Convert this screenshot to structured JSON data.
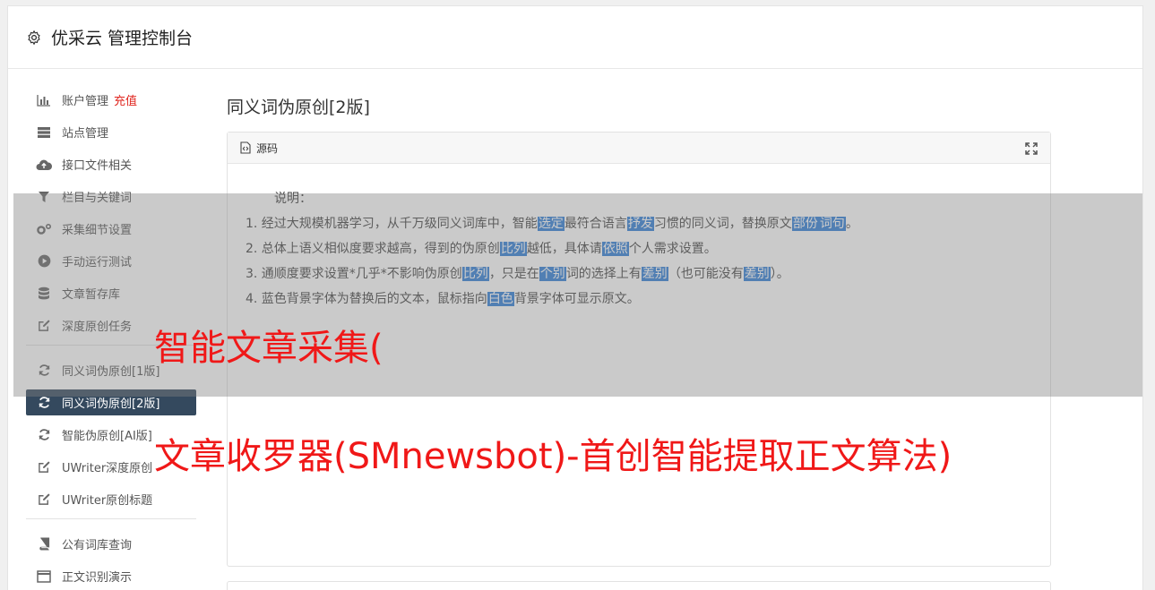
{
  "header": {
    "title": "优采云 管理控制台",
    "icon": "gear-icon"
  },
  "sidebar": {
    "group1": [
      {
        "label": "账户管理",
        "badge": "充值",
        "icon": "bar-chart-icon"
      },
      {
        "label": "站点管理",
        "icon": "server-icon"
      },
      {
        "label": "接口文件相关",
        "icon": "cloud-upload-icon"
      },
      {
        "label": "栏目与关键词",
        "icon": "filter-icon"
      },
      {
        "label": "采集细节设置",
        "icon": "cogs-icon"
      },
      {
        "label": "手动运行测试",
        "icon": "play-circle-icon"
      },
      {
        "label": "文章暂存库",
        "icon": "database-icon"
      },
      {
        "label": "深度原创任务",
        "icon": "edit-icon"
      }
    ],
    "group2": [
      {
        "label": "同义词伪原创[1版]",
        "icon": "refresh-icon"
      },
      {
        "label": "同义词伪原创[2版]",
        "icon": "refresh-icon",
        "active": true
      },
      {
        "label": "智能伪原创[AI版]",
        "icon": "refresh-icon"
      },
      {
        "label": "UWriter深度原创",
        "icon": "edit-icon"
      },
      {
        "label": "UWriter原创标题",
        "icon": "edit-icon"
      }
    ],
    "group3": [
      {
        "label": "公有词库查询",
        "icon": "book-icon"
      },
      {
        "label": "正文识别演示",
        "icon": "window-icon"
      }
    ]
  },
  "main": {
    "title": "同义词伪原创[2版]",
    "panel": {
      "head_label": "源码",
      "head_icon": "code-file-icon",
      "expand_icon": "expand-icon",
      "notes_title": "说明：",
      "notes": [
        [
          "1. 经过大规模机器学习，从千万级同义词库中，智能",
          {
            "hl": "选定"
          },
          "最符合语言",
          {
            "hl": "抒发"
          },
          "习惯的同义词，替换原文",
          {
            "hl": "部份"
          },
          {
            "hl": "词句"
          },
          "。"
        ],
        [
          "2. 总体上语义相似度要求越高，得到的伪原创",
          {
            "hl": "比列"
          },
          "越低，具体请",
          {
            "hl": "依照"
          },
          "个人需求设置。"
        ],
        [
          "3. 通顺度要求设置*几乎*不影响伪原创",
          {
            "hl": "比列"
          },
          "，只是在",
          {
            "hl": "个别"
          },
          "词的选择上有",
          {
            "hl": "差别"
          },
          "（也可能没有",
          {
            "hl": "差别"
          },
          "）。"
        ],
        [
          "4. 蓝色背景字体为替换后的文本，鼠标指向",
          {
            "hl": "白色"
          },
          "背景字体可显示原文。"
        ]
      ]
    }
  },
  "overlay": {
    "line1": "智能文章采集(",
    "line2": "文章收罗器(SMnewsbot)-首创智能提取正文算法)",
    "color": "#f01818"
  }
}
